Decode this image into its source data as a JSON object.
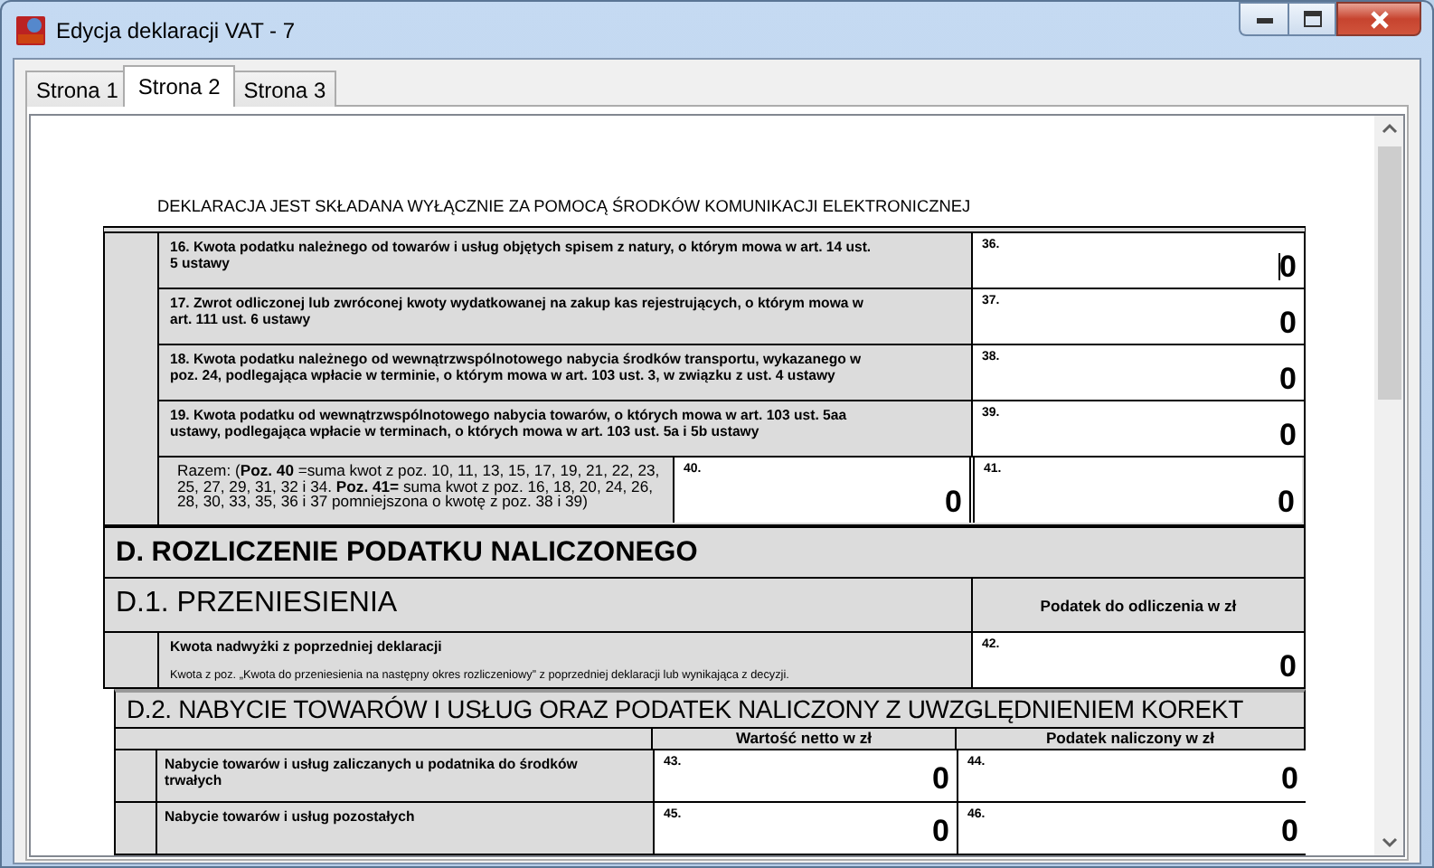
{
  "window": {
    "title": "Edycja deklaracji VAT - 7"
  },
  "tabs": [
    {
      "label": "Strona 1",
      "selected": false
    },
    {
      "label": "Strona 2",
      "selected": true
    },
    {
      "label": "Strona 3",
      "selected": false
    }
  ],
  "notice": "DEKLARACJA JEST SKŁADANA WYŁĄCZNIE ZA POMOCĄ ŚRODKÓW KOMUNIKACJI ELEKTRONICZNEJ",
  "section_c_rows": [
    {
      "label": "16. Kwota podatku należnego od towarów i usług objętych spisem z natury, o którym mowa w art. 14 ust. 5 ustawy",
      "field": {
        "number": "36.",
        "value": "0",
        "focused": true
      }
    },
    {
      "label": "17. Zwrot odliczonej lub zwróconej kwoty wydatkowanej na zakup kas rejestrujących, o którym mowa w art. 111 ust. 6 ustawy",
      "field": {
        "number": "37.",
        "value": "0",
        "focused": false
      }
    },
    {
      "label": "18. Kwota podatku należnego od wewnątrzwspólnotowego nabycia środków transportu, wykazanego w poz. 24, podlegająca wpłacie w terminie, o którym mowa w art. 103 ust. 3, w związku z ust. 4 ustawy",
      "field": {
        "number": "38.",
        "value": "0",
        "focused": false
      }
    },
    {
      "label": "19. Kwota podatku od wewnątrzwspólnotowego nabycia towarów, o których mowa w art. 103 ust. 5aa ustawy, podlegająca wpłacie w terminach, o których mowa w art. 103 ust. 5a i 5b ustawy",
      "field": {
        "number": "39.",
        "value": "0",
        "focused": false
      }
    }
  ],
  "total_row": {
    "label": "Razem: (**Poz. 40** =suma kwot z poz. 10, 11, 13, 15, 17, 19, 21, 22, 23, 25, 27, 29, 31, 32 i 34. **Poz. 41=** suma kwot z poz. 16, 18, 20, 24, 26, 28, 30, 33, 35, 36 i 37 pomniejszona o kwotę z poz. 38 i 39)",
    "fields": [
      {
        "number": "40.",
        "value": "0",
        "focused": false
      },
      {
        "number": "41.",
        "value": "0",
        "focused": false
      }
    ]
  },
  "section_d": {
    "title": "D. ROZLICZENIE PODATKU NALICZONEGO",
    "d1": {
      "title": "D.1. PRZENIESIENIA",
      "column": "Podatek do odliczenia w zł",
      "rows": [
        {
          "label": "Kwota nadwyżki z poprzedniej deklaracji",
          "note": "Kwota z poz. „Kwota do przeniesienia na następny okres rozliczeniowy” z poprzedniej deklaracji lub wynikająca z decyzji.",
          "field": {
            "number": "42.",
            "value": "0",
            "focused": false
          }
        }
      ]
    },
    "d2": {
      "title": "D.2. NABYCIE TOWARÓW I USŁUG ORAZ PODATEK NALICZONY Z UWZGLĘDNIENIEM KOREKT",
      "columns": [
        "Wartość netto w zł",
        "Podatek naliczony w zł"
      ],
      "rows": [
        {
          "label": "Nabycie towarów i usług zaliczanych u podatnika do środków trwałych",
          "fields": [
            {
              "number": "43.",
              "value": "0",
              "focused": false
            },
            {
              "number": "44.",
              "value": "0",
              "focused": false
            }
          ]
        },
        {
          "label": "Nabycie towarów i usług pozostałych",
          "fields": [
            {
              "number": "45.",
              "value": "0",
              "focused": false
            },
            {
              "number": "46.",
              "value": "0",
              "focused": false
            }
          ]
        }
      ]
    }
  }
}
